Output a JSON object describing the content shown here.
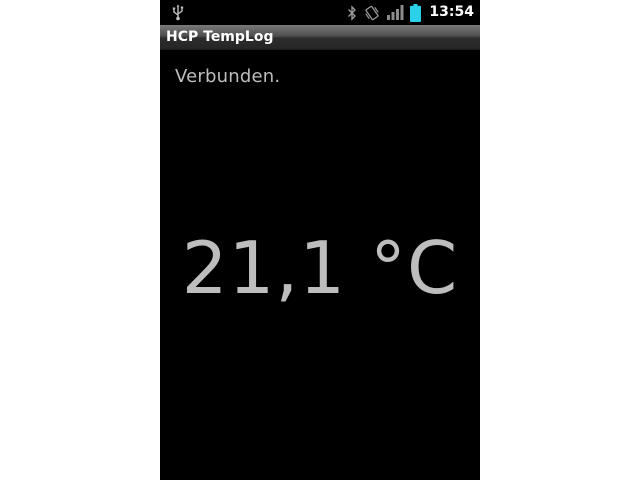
{
  "status_bar": {
    "time": "13:54",
    "icons": [
      "usb-icon",
      "bluetooth-icon",
      "vibrate-icon",
      "signal-icon",
      "battery-icon"
    ],
    "battery_color": "#2bd1e8"
  },
  "app": {
    "title": "HCP TempLog"
  },
  "main": {
    "connection_status": "Verbunden.",
    "temperature": "21,1 °C"
  },
  "colors": {
    "background": "#000000",
    "text": "#bdbdbd"
  }
}
